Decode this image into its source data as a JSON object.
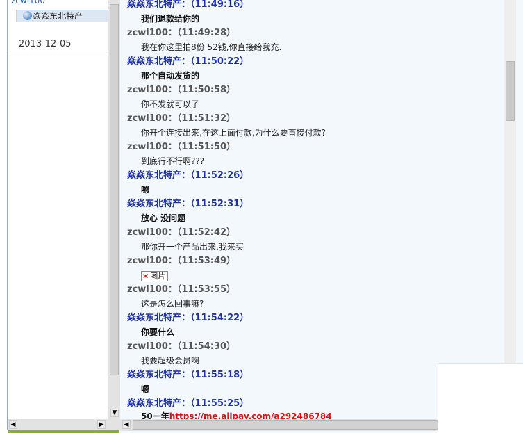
{
  "contacts": {
    "root_label": "zcwl100",
    "item_label": "焱焱东北特产",
    "date": "2013-12-05"
  },
  "chat": {
    "messages": [
      {
        "sender": "焱焱东北特产：",
        "time": "（11:49:16）",
        "text": "我们退款给你的",
        "role": "shop"
      },
      {
        "sender": "zcwl100：",
        "time": "（11:49:28）",
        "text": "我在你这里拍8份 52钱,你直接给我充.",
        "role": "customer"
      },
      {
        "sender": "焱焱东北特产：",
        "time": "（11:50:22）",
        "text": "那个自动发货的",
        "role": "shop"
      },
      {
        "sender": "zcwl100：",
        "time": "（11:50:58）",
        "text": "你不发就可以了",
        "role": "customer"
      },
      {
        "sender": "zcwl100：",
        "time": "（11:51:32）",
        "text": "你开个连接出来,在这上面付款,为什么要直接付款?",
        "role": "customer"
      },
      {
        "sender": "zcwl100：",
        "time": "（11:51:50）",
        "text": "到底行不行啊???",
        "role": "customer"
      },
      {
        "sender": "焱焱东北特产：",
        "time": "（11:52:26）",
        "text": "嗯",
        "role": "shop"
      },
      {
        "sender": "焱焱东北特产：",
        "time": "（11:52:31）",
        "text": "放心 没问题",
        "role": "shop"
      },
      {
        "sender": "zcwl100：",
        "time": "（11:52:42）",
        "text": "那你开一个产品出来,我来买",
        "role": "customer"
      },
      {
        "sender": "zcwl100：",
        "time": "（11:53:49）",
        "text": "图片",
        "role": "customer",
        "is_image": true
      },
      {
        "sender": "zcwl100：",
        "time": "（11:53:55）",
        "text": "这是怎么回事嘛?",
        "role": "customer"
      },
      {
        "sender": "焱焱东北特产：",
        "time": "（11:54:22）",
        "text": "你要什么",
        "role": "shop"
      },
      {
        "sender": "zcwl100：",
        "time": "（11:54:30）",
        "text": "我要超级会员啊",
        "role": "customer"
      },
      {
        "sender": "焱焱东北特产：",
        "time": "（11:55:18）",
        "text": "嗯",
        "role": "shop"
      },
      {
        "sender": "焱焱东北特产：",
        "time": "（11:55:25）",
        "text": "50一年",
        "link": "https://me.alipay.com/a292486784",
        "role": "shop"
      }
    ]
  },
  "colors": {
    "shop_name": "#1e2fa8",
    "customer_name": "#555555",
    "link": "#e01010",
    "chat_bg": "#f3f8fd",
    "accent_green": "#88ad3c"
  },
  "icons": {
    "contact": "user-avatar-icon",
    "broken_image": "broken-image-icon",
    "arrow_up": "arrow-up-icon",
    "arrow_down": "arrow-down-icon",
    "arrow_left": "arrow-left-icon",
    "arrow_right": "arrow-right-icon"
  }
}
